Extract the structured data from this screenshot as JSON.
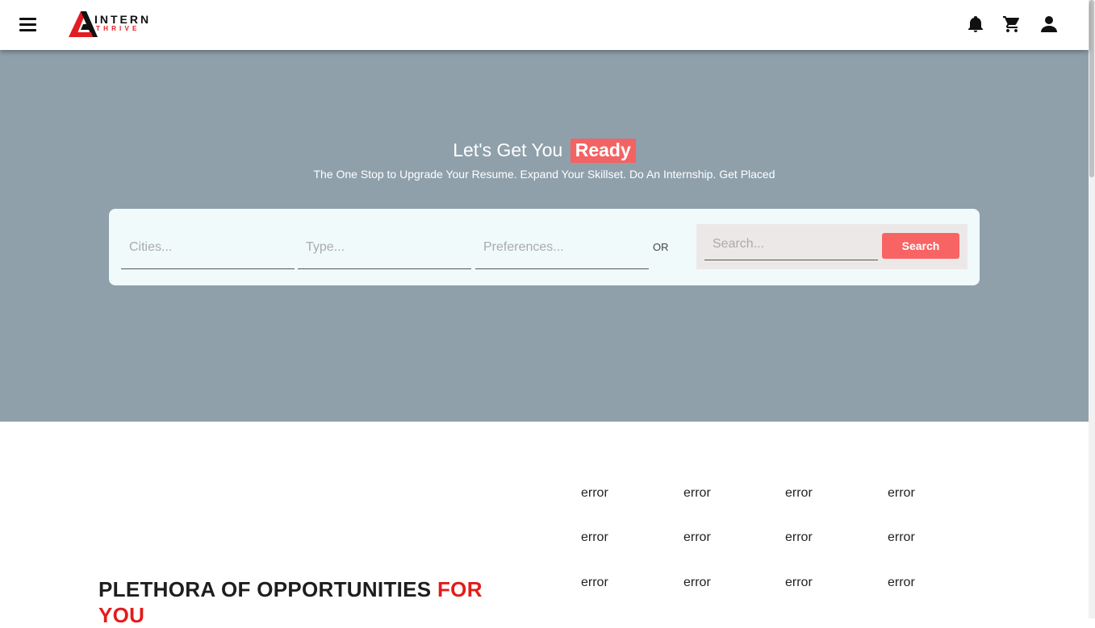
{
  "navbar": {
    "logo": {
      "top": "INTERN",
      "bottom": "THRIVE"
    },
    "icons": [
      "bell-icon",
      "cart-icon",
      "user-icon"
    ]
  },
  "hero": {
    "title_prefix": "Let's Get You",
    "title_highlight": "Ready",
    "subtitle": "The One Stop to Upgrade Your Resume. Expand Your Skillset. Do An Internship. Get Placed",
    "filters": [
      {
        "placeholder": "Cities..."
      },
      {
        "placeholder": "Type..."
      },
      {
        "placeholder": "Preferences..."
      }
    ],
    "or_label": "OR",
    "search": {
      "placeholder": "Search...",
      "button_label": "Search"
    }
  },
  "colors": {
    "hero_bg": "#8fa0ab",
    "accent": "#f86464",
    "card_bg": "#f1fafb",
    "heading_red": "#e41b1b"
  },
  "opportunities": {
    "heading_main": "PLETHORA OF OPPORTUNITIES",
    "heading_red": "FOR YOU",
    "images": [
      [
        "error",
        "error",
        "error",
        "error"
      ],
      [
        "error",
        "error",
        "error",
        "error"
      ],
      [
        "error",
        "error",
        "error",
        "error"
      ]
    ]
  }
}
